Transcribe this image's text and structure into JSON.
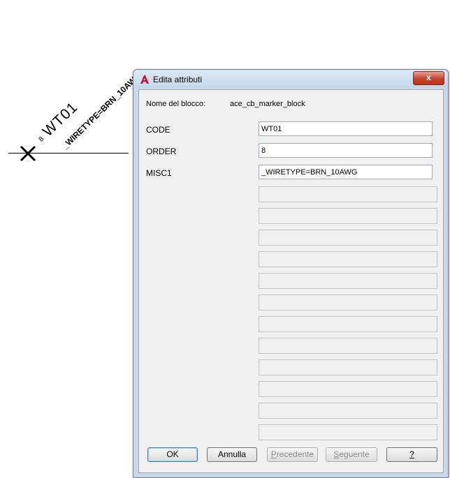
{
  "drawing": {
    "order_label": "8",
    "code_label": "WT01",
    "wiretype_label": "_WIRETYPE=BRN_10AWG"
  },
  "dialog": {
    "title": "Edita attributi",
    "close_label": "x",
    "block_name_label": "Nome del blocco:",
    "block_name_value": "ace_cb_marker_block",
    "attributes": [
      {
        "label": "CODE",
        "value": "WT01"
      },
      {
        "label": "ORDER",
        "value": "8"
      },
      {
        "label": "MISC1",
        "value": "_WIRETYPE=BRN_10AWG"
      }
    ],
    "buttons": {
      "ok": "OK",
      "cancel": "Annulla",
      "previous_first": "P",
      "previous_rest": "recedente",
      "next_first": "S",
      "next_rest": "eguente",
      "help": "?"
    }
  }
}
